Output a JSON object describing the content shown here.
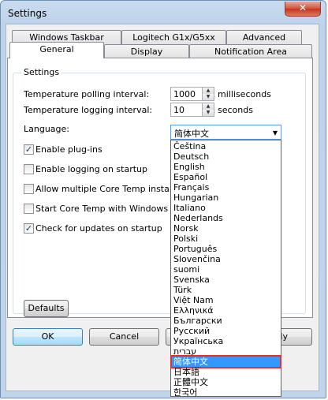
{
  "window": {
    "title": "Settings",
    "close_label": "✕"
  },
  "tabs": {
    "row1": [
      {
        "key": "windows_taskbar",
        "label": "Windows Taskbar"
      },
      {
        "key": "logitech",
        "label": "Logitech G1x/G5xx"
      },
      {
        "key": "advanced",
        "label": "Advanced"
      }
    ],
    "row2": [
      {
        "key": "general",
        "label": "General",
        "active": true
      },
      {
        "key": "display",
        "label": "Display"
      },
      {
        "key": "notification_area",
        "label": "Notification Area"
      }
    ]
  },
  "settings": {
    "group_title": "Settings",
    "polling_label": "Temperature polling interval:",
    "polling_value": "1000",
    "polling_unit": "milliseconds",
    "logging_label": "Temperature logging interval:",
    "logging_value": "10",
    "logging_unit": "seconds",
    "language_label": "Language:",
    "language_value": "简体中文",
    "checkboxes": [
      {
        "label": "Enable plug-ins",
        "checked": true
      },
      {
        "label": "Enable logging on startup",
        "checked": false
      },
      {
        "label": "Allow multiple Core Temp instances",
        "checked": false
      },
      {
        "label": "Start Core Temp with Windows",
        "checked": false
      },
      {
        "label": "Check for updates on startup",
        "checked": true
      }
    ],
    "defaults_label": "Defaults"
  },
  "buttons": {
    "ok": "OK",
    "cancel": "Cancel",
    "apply_partial": "ly"
  },
  "language_options": [
    "Čeština",
    "Deutsch",
    "English",
    "Español",
    "Français",
    "Hungarian",
    "Italiano",
    "Nederlands",
    "Norsk",
    "Polski",
    "Português",
    "Slovenčina",
    "suomi",
    "Svenska",
    "Türk",
    "Việt Nam",
    "Ελληνικά",
    "Български",
    "Русский",
    "Українська",
    "עברית",
    "简体中文",
    "日本語",
    "正體中文",
    "한국어"
  ],
  "selected_language_index": 21,
  "colors": {
    "selection": "#3399ff",
    "highlight_outline": "#e03030",
    "title_gradient": "#bed3ea"
  }
}
